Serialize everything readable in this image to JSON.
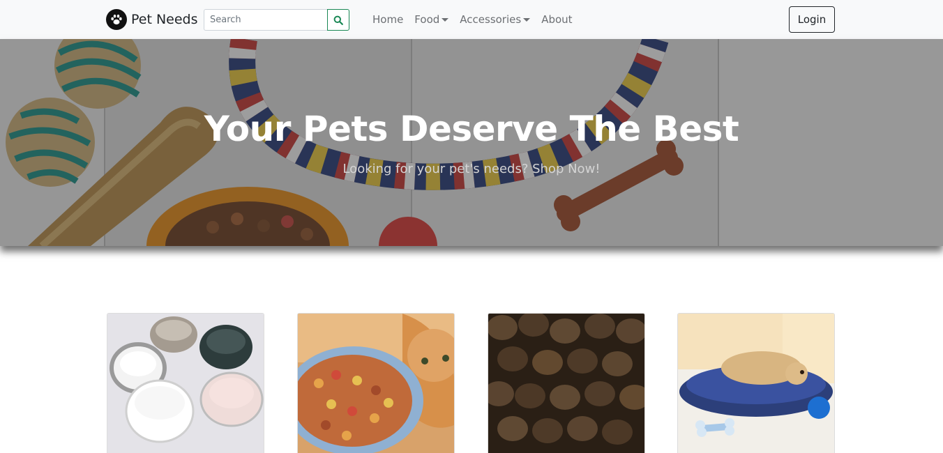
{
  "brand": {
    "name": "Pet Needs",
    "logo_icon": "paw-icon"
  },
  "search": {
    "placeholder": "Search",
    "value": "",
    "button_icon": "search-icon"
  },
  "nav": {
    "items": [
      {
        "label": "Home",
        "dropdown": false
      },
      {
        "label": "Food",
        "dropdown": true
      },
      {
        "label": "Accessories",
        "dropdown": true
      },
      {
        "label": "About",
        "dropdown": false
      }
    ]
  },
  "login": {
    "label": "Login"
  },
  "hero": {
    "title": "Your Pets Deserve The Best",
    "subtitle": "Looking for your pet's needs? Shop Now!"
  },
  "cards": [
    {
      "image": "pet-bowls-image"
    },
    {
      "image": "cat-food-bowl-image"
    },
    {
      "image": "dry-kibble-image"
    },
    {
      "image": "dog-bed-image"
    }
  ],
  "colors": {
    "accent": "#198754",
    "navbar_bg": "#f8f9fa",
    "text_dark": "#212529"
  }
}
